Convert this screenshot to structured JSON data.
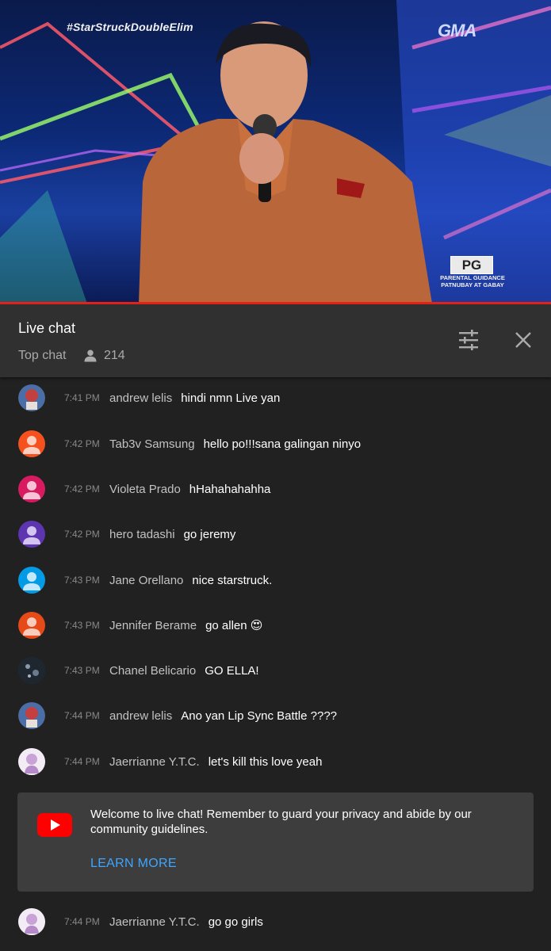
{
  "video": {
    "hashtag": "#StarStruckDoubleElim",
    "channel_logo": "GMA",
    "rating_badge": "PG",
    "rating_sub": "PARENTAL GUIDANCE PATNUBAY AT GABAY",
    "progress_color": "#e62117"
  },
  "chat_header": {
    "title": "Live chat",
    "mode": "Top chat",
    "viewer_count": "214",
    "filter_icon": "sliders-icon",
    "close_icon": "close-icon"
  },
  "messages": [
    {
      "time": "7:41 PM",
      "author": "andrew lelis",
      "text": "hindi nmn Live yan",
      "avatar_color": "#6b2a2a"
    },
    {
      "time": "7:42 PM",
      "author": "Tab3v Samsung",
      "text": "hello po!!!sana galingan ninyo",
      "avatar_color": "#f4511e"
    },
    {
      "time": "7:42 PM",
      "author": "Violeta Prado",
      "text": "hHahahahahha",
      "avatar_color": "#d81b60"
    },
    {
      "time": "7:42 PM",
      "author": "hero tadashi",
      "text": "go jeremy",
      "avatar_color": "#5e35b1"
    },
    {
      "time": "7:43 PM",
      "author": "Jane Orellano",
      "text": "nice starstruck.",
      "avatar_color": "#039be5"
    },
    {
      "time": "7:43 PM",
      "author": "Jennifer Berame",
      "text": "go allen 😍",
      "avatar_color": "#e64a19"
    },
    {
      "time": "7:43 PM",
      "author": "Chanel Belicario",
      "text": "GO ELLA!",
      "avatar_color": "#2b3440"
    },
    {
      "time": "7:44 PM",
      "author": "andrew lelis",
      "text": "Ano yan Lip Sync Battle ????",
      "avatar_color": "#6b2a2a"
    },
    {
      "time": "7:44 PM",
      "author": "Jaerrianne Y.T.C.",
      "text": "let's kill this love yeah",
      "avatar_color": "#efe6f2"
    }
  ],
  "welcome": {
    "text": "Welcome to live chat! Remember to guard your privacy and abide by our community guidelines.",
    "learn_more": "LEARN MORE",
    "icon": "youtube-icon"
  },
  "last_message": {
    "time": "7:44 PM",
    "author": "Jaerrianne Y.T.C.",
    "text": "go go girls",
    "avatar_color": "#efe6f2"
  }
}
